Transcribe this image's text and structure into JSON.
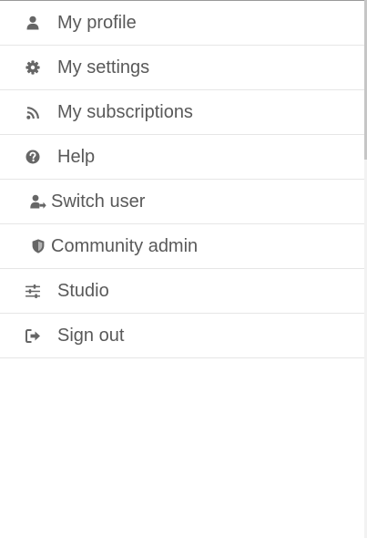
{
  "menu": {
    "items": [
      {
        "label": "My profile",
        "icon": "user-icon"
      },
      {
        "label": "My settings",
        "icon": "gear-icon"
      },
      {
        "label": "My subscriptions",
        "icon": "rss-icon"
      },
      {
        "label": "Help",
        "icon": "question-circle-icon"
      },
      {
        "label": "Switch user",
        "icon": "switch-user-icon"
      },
      {
        "label": "Community admin",
        "icon": "shield-icon"
      },
      {
        "label": "Studio",
        "icon": "sliders-icon"
      },
      {
        "label": "Sign out",
        "icon": "sign-out-icon"
      }
    ]
  },
  "colors": {
    "text": "#595959",
    "icon": "#666666",
    "divider": "#e6e6e6",
    "background": "#ffffff"
  }
}
